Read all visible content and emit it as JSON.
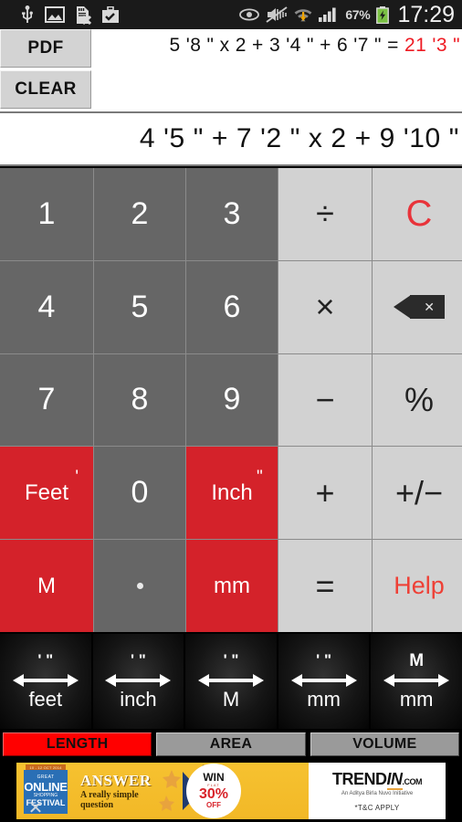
{
  "statusbar": {
    "icons_left": [
      "usb-icon",
      "image-icon",
      "sdcard-removed-icon",
      "briefcase-check-icon"
    ],
    "icons_right": [
      "eye-icon",
      "mute-vibrate-icon",
      "wifi-icon",
      "signal-icon"
    ],
    "battery_percent": "67%",
    "battery_icon": "battery-charging-icon",
    "clock": "17:29"
  },
  "toolbar": {
    "pdf_label": "PDF",
    "clear_label": "CLEAR"
  },
  "history": {
    "expression": "5 '8 \" x 2 + 3 '4 \" + 6 '7 \" = ",
    "result": "21 '3 \""
  },
  "display": {
    "value": "4 '5 \" + 7 '2 \" x 2 + 9 '10 \""
  },
  "keypad": {
    "rows": [
      [
        {
          "label": "1",
          "style": "num",
          "name": "key-1"
        },
        {
          "label": "2",
          "style": "num",
          "name": "key-2"
        },
        {
          "label": "3",
          "style": "num",
          "name": "key-3"
        },
        {
          "label": "÷",
          "style": "op",
          "name": "key-divide"
        },
        {
          "label": "C",
          "style": "clear",
          "name": "key-clear-c"
        }
      ],
      [
        {
          "label": "4",
          "style": "num",
          "name": "key-4"
        },
        {
          "label": "5",
          "style": "num",
          "name": "key-5"
        },
        {
          "label": "6",
          "style": "num",
          "name": "key-6"
        },
        {
          "label": "×",
          "style": "op",
          "name": "key-multiply"
        },
        {
          "label": "",
          "style": "backspace",
          "name": "key-backspace"
        }
      ],
      [
        {
          "label": "7",
          "style": "num",
          "name": "key-7"
        },
        {
          "label": "8",
          "style": "num",
          "name": "key-8"
        },
        {
          "label": "9",
          "style": "num",
          "name": "key-9"
        },
        {
          "label": "−",
          "style": "op",
          "name": "key-minus"
        },
        {
          "label": "%",
          "style": "op",
          "name": "key-percent"
        }
      ],
      [
        {
          "label": "Feet",
          "sup": "'",
          "style": "red",
          "name": "key-feet"
        },
        {
          "label": "0",
          "style": "num",
          "name": "key-0"
        },
        {
          "label": "Inch",
          "sup": "\"",
          "style": "red",
          "name": "key-inch"
        },
        {
          "label": "+",
          "style": "op",
          "name": "key-plus"
        },
        {
          "label": "+/−",
          "style": "op",
          "name": "key-sign"
        }
      ],
      [
        {
          "label": "M",
          "style": "red",
          "name": "key-meter"
        },
        {
          "label": "",
          "style": "dot",
          "name": "key-decimal"
        },
        {
          "label": "mm",
          "style": "red",
          "name": "key-millimeter"
        },
        {
          "label": "=",
          "style": "op",
          "name": "key-equals"
        },
        {
          "label": "Help",
          "style": "help",
          "name": "key-help"
        }
      ]
    ]
  },
  "conversions": [
    {
      "top": "' \"",
      "label": "feet",
      "name": "convert-to-feet"
    },
    {
      "top": "' \"",
      "label": "inch",
      "name": "convert-to-inch"
    },
    {
      "top": "' \"",
      "label": "M",
      "name": "convert-to-meter"
    },
    {
      "top": "' \"",
      "label": "mm",
      "name": "convert-to-millimeter"
    },
    {
      "top": "M",
      "label": "mm",
      "name": "convert-meter-to-millimeter"
    }
  ],
  "tabs": [
    {
      "label": "LENGTH",
      "active": true,
      "name": "tab-length"
    },
    {
      "label": "AREA",
      "active": false,
      "name": "tab-area"
    },
    {
      "label": "VOLUME",
      "active": false,
      "name": "tab-volume"
    }
  ],
  "ad": {
    "badge_cap": "10 - 12 OCT 2014",
    "badge_t1": "GREAT",
    "badge_t2": "ONLINE",
    "badge_t3": "SHOPPING",
    "badge_t4": "FESTIVAL",
    "headline": "ANSWER",
    "sub1": "A really simple",
    "sub2": "question",
    "circle_win": "WIN",
    "circle_play": "FLAT",
    "circle_off_pct": "30%",
    "circle_off": "OFF",
    "brand_a": "TREND",
    "brand_b": "IN",
    "brand_com": ".COM",
    "brand_sub": "An Aditya Birla Nuvo Initiative",
    "terms": "*T&C APPLY"
  },
  "colors": {
    "red_key": "#d4222a",
    "num_key": "#666666",
    "op_key": "#d2d2d2",
    "accent_red": "#ee1b23",
    "tab_active": "#ff0000"
  }
}
